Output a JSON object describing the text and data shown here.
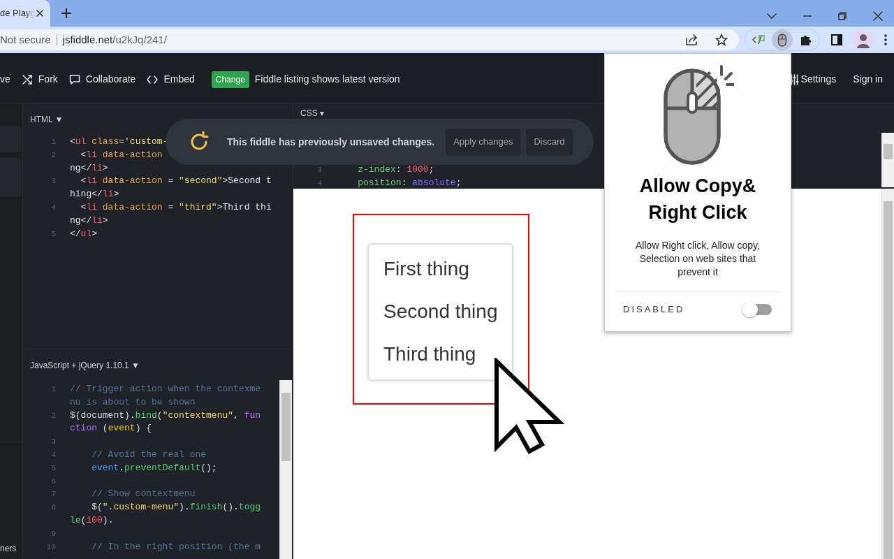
{
  "browser": {
    "tabs": [
      {
        "title": "de Playg",
        "selected": true
      }
    ],
    "address": {
      "security": "Not secure",
      "host": "jsfiddle.net",
      "path": "/u2kJq/241/"
    },
    "extensions": [
      {
        "kind": "code",
        "selected": false
      },
      {
        "kind": "mouse",
        "selected": true
      },
      {
        "kind": "puzzle",
        "selected": false
      }
    ]
  },
  "fiddle_toolbar": {
    "actions": [
      {
        "label": "ve",
        "kind": "plain"
      },
      {
        "label": "Fork",
        "kind": "fork"
      },
      {
        "label": "Collaborate",
        "kind": "chat"
      },
      {
        "label": "Embed",
        "kind": "code"
      }
    ],
    "badge": "Change",
    "notice": "Fiddle listing shows latest version",
    "right_actions": [
      {
        "label": "Settings",
        "kind": "sliders"
      },
      {
        "label": "Sign in",
        "kind": "plain"
      }
    ]
  },
  "sidebar": {
    "footer_text": "ners"
  },
  "html_panel": {
    "title": "HTML",
    "caret": "▼",
    "rows": [
      {
        "number": "1",
        "tokens": [
          {
            "kind": "punct",
            "text": "<"
          },
          {
            "kind": "tag",
            "text": "ul"
          },
          {
            "kind": "attr",
            "text": " class"
          },
          {
            "kind": "punct",
            "text": "="
          },
          {
            "kind": "string",
            "text": "'custom-"
          }
        ]
      },
      {
        "number": "2",
        "tokens": [
          {
            "kind": "punct",
            "text": "  <"
          },
          {
            "kind": "tag",
            "text": "li"
          },
          {
            "kind": "attr",
            "text": " data-action"
          }
        ]
      },
      {
        "tokens": [
          {
            "kind": "text",
            "text": "ng"
          },
          {
            "kind": "punct",
            "text": "</"
          },
          {
            "kind": "tag",
            "text": "li"
          },
          {
            "kind": "punct",
            "text": ">"
          }
        ]
      },
      {
        "number": "3",
        "tokens": [
          {
            "kind": "punct",
            "text": "  <"
          },
          {
            "kind": "tag",
            "text": "li"
          },
          {
            "kind": "attr",
            "text": " data-action"
          },
          {
            "kind": "punct",
            "text": " = "
          },
          {
            "kind": "string",
            "text": "\"second\""
          },
          {
            "kind": "punct",
            "text": ">"
          },
          {
            "kind": "text",
            "text": "Second t"
          }
        ]
      },
      {
        "tokens": [
          {
            "kind": "text",
            "text": "hing"
          },
          {
            "kind": "punct",
            "text": "</"
          },
          {
            "kind": "tag",
            "text": "li"
          },
          {
            "kind": "punct",
            "text": ">"
          }
        ]
      },
      {
        "number": "4",
        "tokens": [
          {
            "kind": "punct",
            "text": "  <"
          },
          {
            "kind": "tag",
            "text": "li"
          },
          {
            "kind": "attr",
            "text": " data-action"
          },
          {
            "kind": "punct",
            "text": " = "
          },
          {
            "kind": "string",
            "text": "\"third\""
          },
          {
            "kind": "punct",
            "text": ">"
          },
          {
            "kind": "text",
            "text": "Third thi"
          }
        ]
      },
      {
        "tokens": [
          {
            "kind": "text",
            "text": "ng"
          },
          {
            "kind": "punct",
            "text": "</"
          },
          {
            "kind": "tag",
            "text": "li"
          },
          {
            "kind": "punct",
            "text": ">"
          }
        ]
      },
      {
        "number": "5",
        "tokens": [
          {
            "kind": "punct",
            "text": "</"
          },
          {
            "kind": "tag",
            "text": "ul"
          },
          {
            "kind": "punct",
            "text": ">"
          }
        ]
      }
    ]
  },
  "js_panel": {
    "title": "JavaScript + jQuery 1.10.1",
    "caret": "▼",
    "rows": [
      {
        "number": "1",
        "tokens": [
          {
            "kind": "comment",
            "text": "// Trigger action when the contexme"
          }
        ]
      },
      {
        "tokens": [
          {
            "kind": "comment",
            "text": "nu is about to be shown"
          }
        ]
      },
      {
        "number": "2",
        "tokens": [
          {
            "kind": "punct",
            "text": "$(document)."
          },
          {
            "kind": "func",
            "text": "bind"
          },
          {
            "kind": "punct",
            "text": "("
          },
          {
            "kind": "string",
            "text": "\"contextmenu\""
          },
          {
            "kind": "punct",
            "text": ", "
          },
          {
            "kind": "keyword",
            "text": "fun"
          }
        ]
      },
      {
        "tokens": [
          {
            "kind": "keyword",
            "text": "ction"
          },
          {
            "kind": "punct",
            "text": " ("
          },
          {
            "kind": "param",
            "text": "event"
          },
          {
            "kind": "punct",
            "text": ") {"
          }
        ]
      },
      {
        "number": "3"
      },
      {
        "number": "4",
        "tokens": [
          {
            "kind": "comment",
            "text": "    // Avoid the real one"
          }
        ]
      },
      {
        "number": "5",
        "tokens": [
          {
            "kind": "prop",
            "text": "    event"
          },
          {
            "kind": "punct",
            "text": "."
          },
          {
            "kind": "func",
            "text": "preventDefault"
          },
          {
            "kind": "punct",
            "text": "();"
          }
        ]
      },
      {
        "number": "6"
      },
      {
        "number": "7",
        "tokens": [
          {
            "kind": "comment",
            "text": "    // Show contextmenu"
          }
        ]
      },
      {
        "number": "8",
        "tokens": [
          {
            "kind": "punct",
            "text": "    $("
          },
          {
            "kind": "string",
            "text": "\".custom-menu\""
          },
          {
            "kind": "punct",
            "text": ")."
          },
          {
            "kind": "func",
            "text": "finish"
          },
          {
            "kind": "punct",
            "text": "()."
          },
          {
            "kind": "func",
            "text": "togg"
          }
        ]
      },
      {
        "tokens": [
          {
            "kind": "func",
            "text": "le"
          },
          {
            "kind": "punct",
            "text": "("
          },
          {
            "kind": "number",
            "text": "100"
          },
          {
            "kind": "punct",
            "text": ")."
          }
        ]
      },
      {
        "number": "9"
      },
      {
        "number": "10",
        "tokens": [
          {
            "kind": "comment",
            "text": "    // In the right position (the m"
          }
        ]
      }
    ]
  },
  "css_panel": {
    "title": "CSS",
    "caret": "▾",
    "rows": [
      {
        "number": "3",
        "tokens": [
          {
            "kind": "cssprop",
            "text": "    z-index"
          },
          {
            "kind": "punct",
            "text": ": "
          },
          {
            "kind": "number",
            "text": "1000"
          },
          {
            "kind": "punct",
            "text": ";"
          }
        ]
      },
      {
        "number": "4",
        "tokens": [
          {
            "kind": "cssprop",
            "text": "    position"
          },
          {
            "kind": "punct",
            "text": ": "
          },
          {
            "kind": "cssval",
            "text": "absolute"
          },
          {
            "kind": "punct",
            "text": ";"
          }
        ]
      }
    ]
  },
  "toast": {
    "message": "This fiddle has previously unsaved changes.",
    "buttons": [
      "Apply changes",
      "Discard"
    ]
  },
  "result": {
    "menu_items": [
      "First thing",
      "Second thing",
      "Third thing"
    ]
  },
  "popup": {
    "title": "Allow Copy& Right Click",
    "description": "Allow Right click, Allow copy, Selection on web sites that prevent it",
    "toggle": {
      "label": "DISABLED",
      "on": false
    }
  }
}
